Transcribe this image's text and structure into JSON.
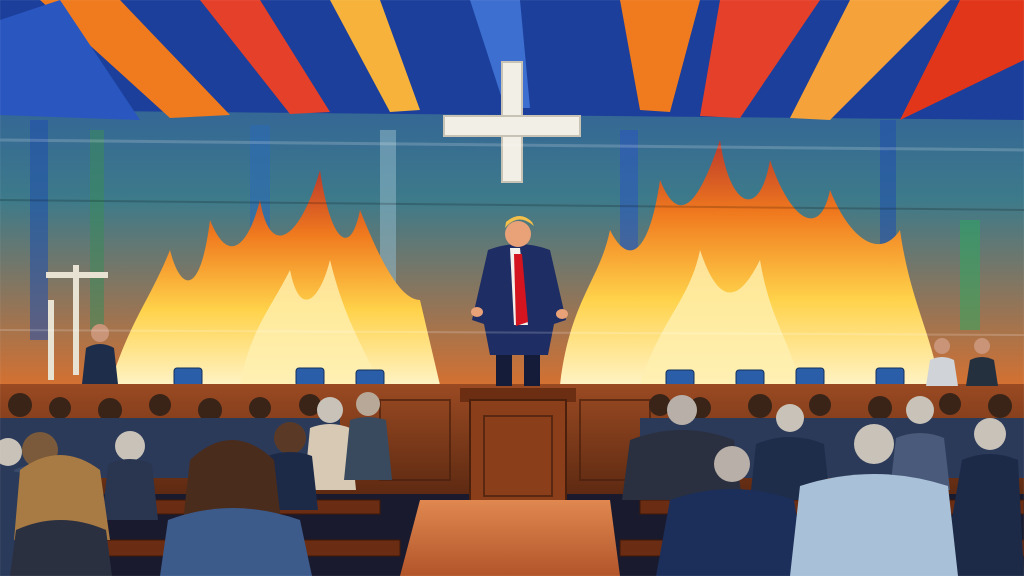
{
  "scene": {
    "subject": "painting",
    "palette": {
      "ceiling_blue": "#1f4fae",
      "ceiling_orange": "#f07a1e",
      "flame_yellow": "#ffd24a",
      "flame_red": "#e2361a",
      "wood": "#7a3a1c",
      "suit": "#1e2d63",
      "tie": "#d4151f",
      "cross": "#f2efe6"
    }
  }
}
